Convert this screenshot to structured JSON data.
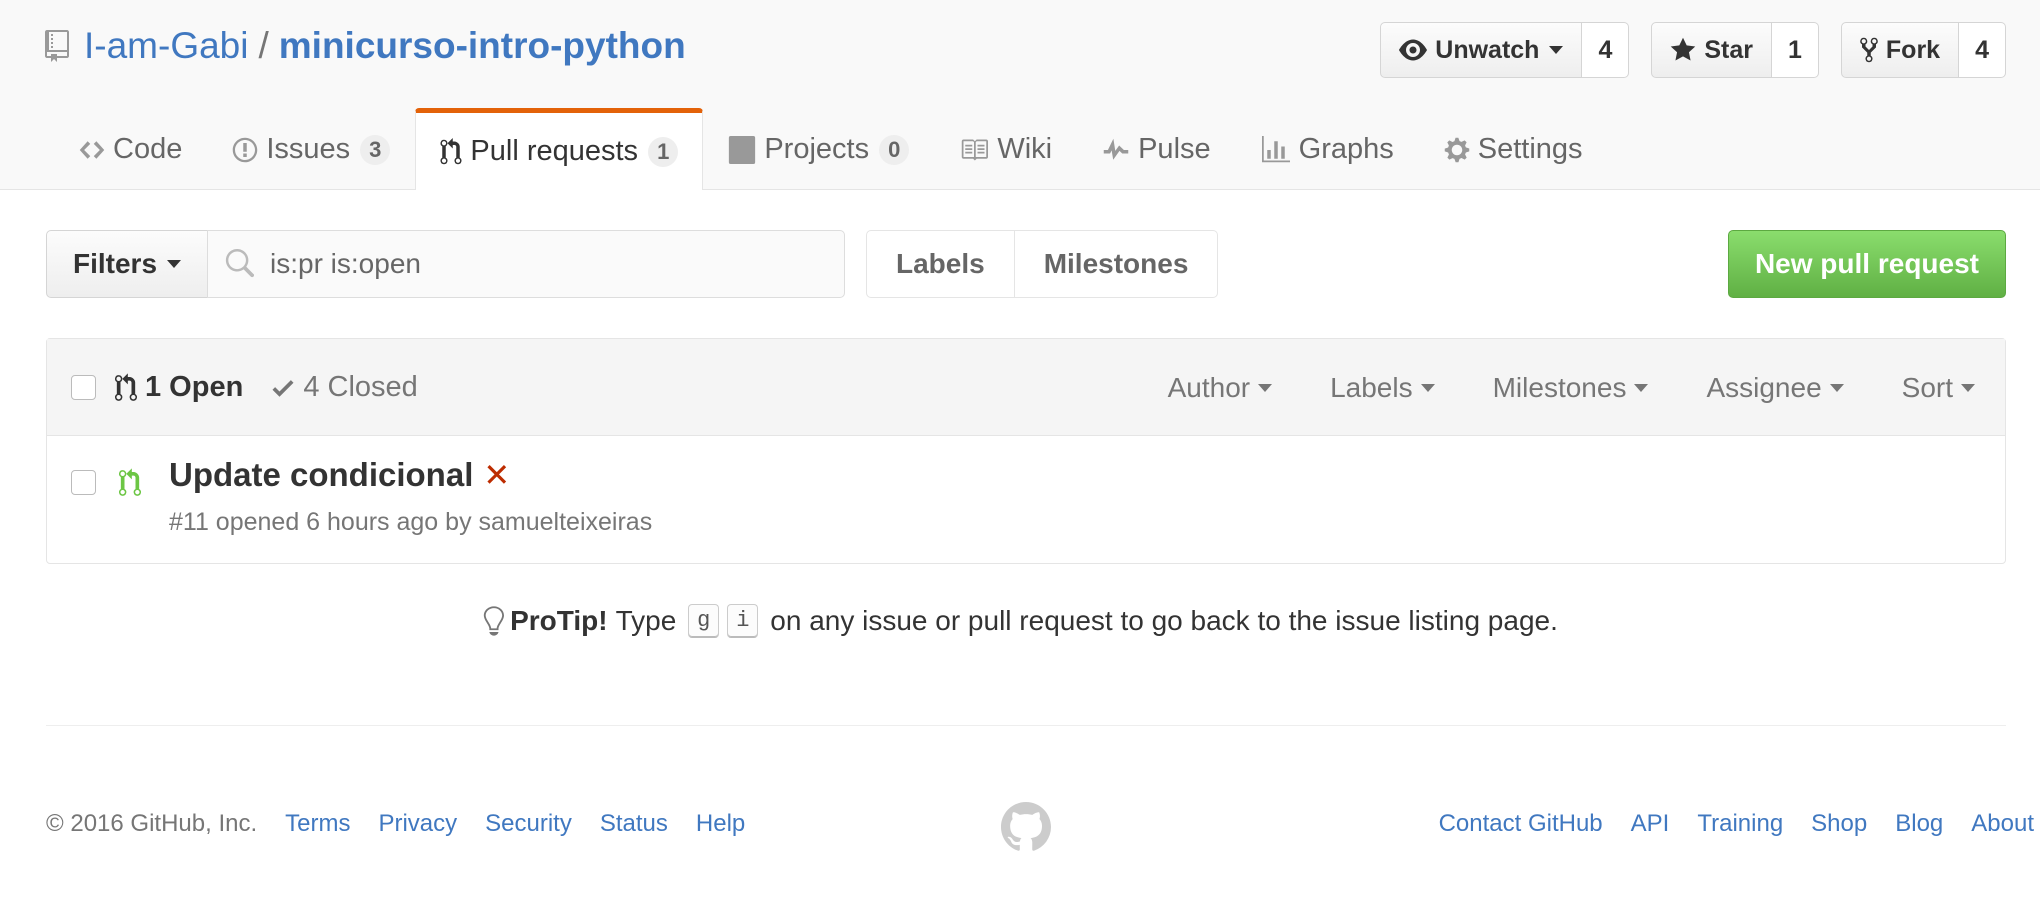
{
  "repo": {
    "owner": "I-am-Gabi",
    "separator": "/",
    "name": "minicurso-intro-python"
  },
  "actions": {
    "watch": {
      "label": "Unwatch",
      "count": "4"
    },
    "star": {
      "label": "Star",
      "count": "1"
    },
    "fork": {
      "label": "Fork",
      "count": "4"
    }
  },
  "nav": {
    "code": "Code",
    "issues": "Issues",
    "issues_count": "3",
    "pulls": "Pull requests",
    "pulls_count": "1",
    "projects": "Projects",
    "projects_count": "0",
    "wiki": "Wiki",
    "pulse": "Pulse",
    "graphs": "Graphs",
    "settings": "Settings"
  },
  "subnav": {
    "filters": "Filters",
    "search_value": "is:pr is:open",
    "labels": "Labels",
    "milestones": "Milestones",
    "new_pr": "New pull request"
  },
  "listing": {
    "open": "1 Open",
    "closed": "4 Closed",
    "menus": {
      "author": "Author",
      "labels": "Labels",
      "milestones": "Milestones",
      "assignee": "Assignee",
      "sort": "Sort"
    },
    "rows": [
      {
        "title": "Update condicional",
        "meta": "#11 opened 6 hours ago by samuelteixeiras"
      }
    ]
  },
  "protip": {
    "label": "ProTip!",
    "before": "Type",
    "key1": "g",
    "key2": "i",
    "after": "on any issue or pull request to go back to the issue listing page."
  },
  "footer": {
    "copyright": "© 2016 GitHub, Inc.",
    "left_links": [
      "Terms",
      "Privacy",
      "Security",
      "Status",
      "Help"
    ],
    "right_links": [
      "Contact GitHub",
      "API",
      "Training",
      "Shop",
      "Blog",
      "About"
    ]
  },
  "colors": {
    "link": "#4078c0",
    "accent_tab": "#e36209",
    "new_pr_green": "#60b044",
    "open_pr_icon": "#6cc644",
    "failure_x": "#bd2c00"
  }
}
